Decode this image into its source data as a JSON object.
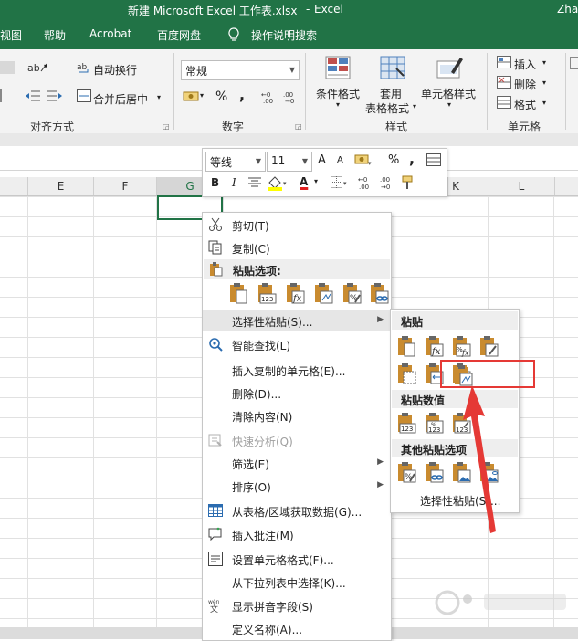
{
  "title": {
    "document": "新建 Microsoft Excel 工作表.xlsx",
    "separator": "-",
    "app": "Excel",
    "user": "Zha"
  },
  "menu": {
    "items": [
      "视图",
      "帮助",
      "Acrobat",
      "百度网盘",
      "操作说明搜索"
    ]
  },
  "ribbon": {
    "wrap_text": "自动换行",
    "merge_center": "合并后居中",
    "alignment_group": "对齐方式",
    "number_format": "常规",
    "percent": "%",
    "comma": ",",
    "number_group": "数字",
    "conditional_format": "条件格式",
    "table_format_1": "套用",
    "table_format_2": "表格格式",
    "cell_styles": "单元格样式",
    "styles_group": "样式",
    "insert": "插入",
    "delete": "删除",
    "format": "格式",
    "cells_group": "单元格"
  },
  "columns": [
    "E",
    "F",
    "G",
    "K",
    "L"
  ],
  "mini_toolbar": {
    "font": "等线",
    "size": "11",
    "grow": "A",
    "shrink": "A",
    "percent": "%",
    "comma": ",",
    "bold": "B",
    "italic": "I",
    "font_color": "A"
  },
  "context_menu": {
    "cut": "剪切(T)",
    "copy": "复制(C)",
    "paste_options": "粘贴选项:",
    "paste_special": "选择性粘贴(S)...",
    "smart_lookup": "智能查找(L)",
    "insert_copied": "插入复制的单元格(E)...",
    "delete": "删除(D)...",
    "clear": "清除内容(N)",
    "quick_analysis": "快速分析(Q)",
    "filter": "筛选(E)",
    "sort": "排序(O)",
    "get_data": "从表格/区域获取数据(G)...",
    "insert_comment": "插入批注(M)",
    "format_cells": "设置单元格格式(F)...",
    "pick_list": "从下拉列表中选择(K)...",
    "phonetic": "显示拼音字段(S)",
    "define_name": "定义名称(A)..."
  },
  "submenu": {
    "paste": "粘贴",
    "paste_values": "粘贴数值",
    "other_paste": "其他粘贴选项",
    "paste_special": "选择性粘贴(S)..."
  },
  "colors": {
    "excel_green": "#217346",
    "highlight_red": "#e53935",
    "clipboard_orange": "#c98b2f"
  }
}
